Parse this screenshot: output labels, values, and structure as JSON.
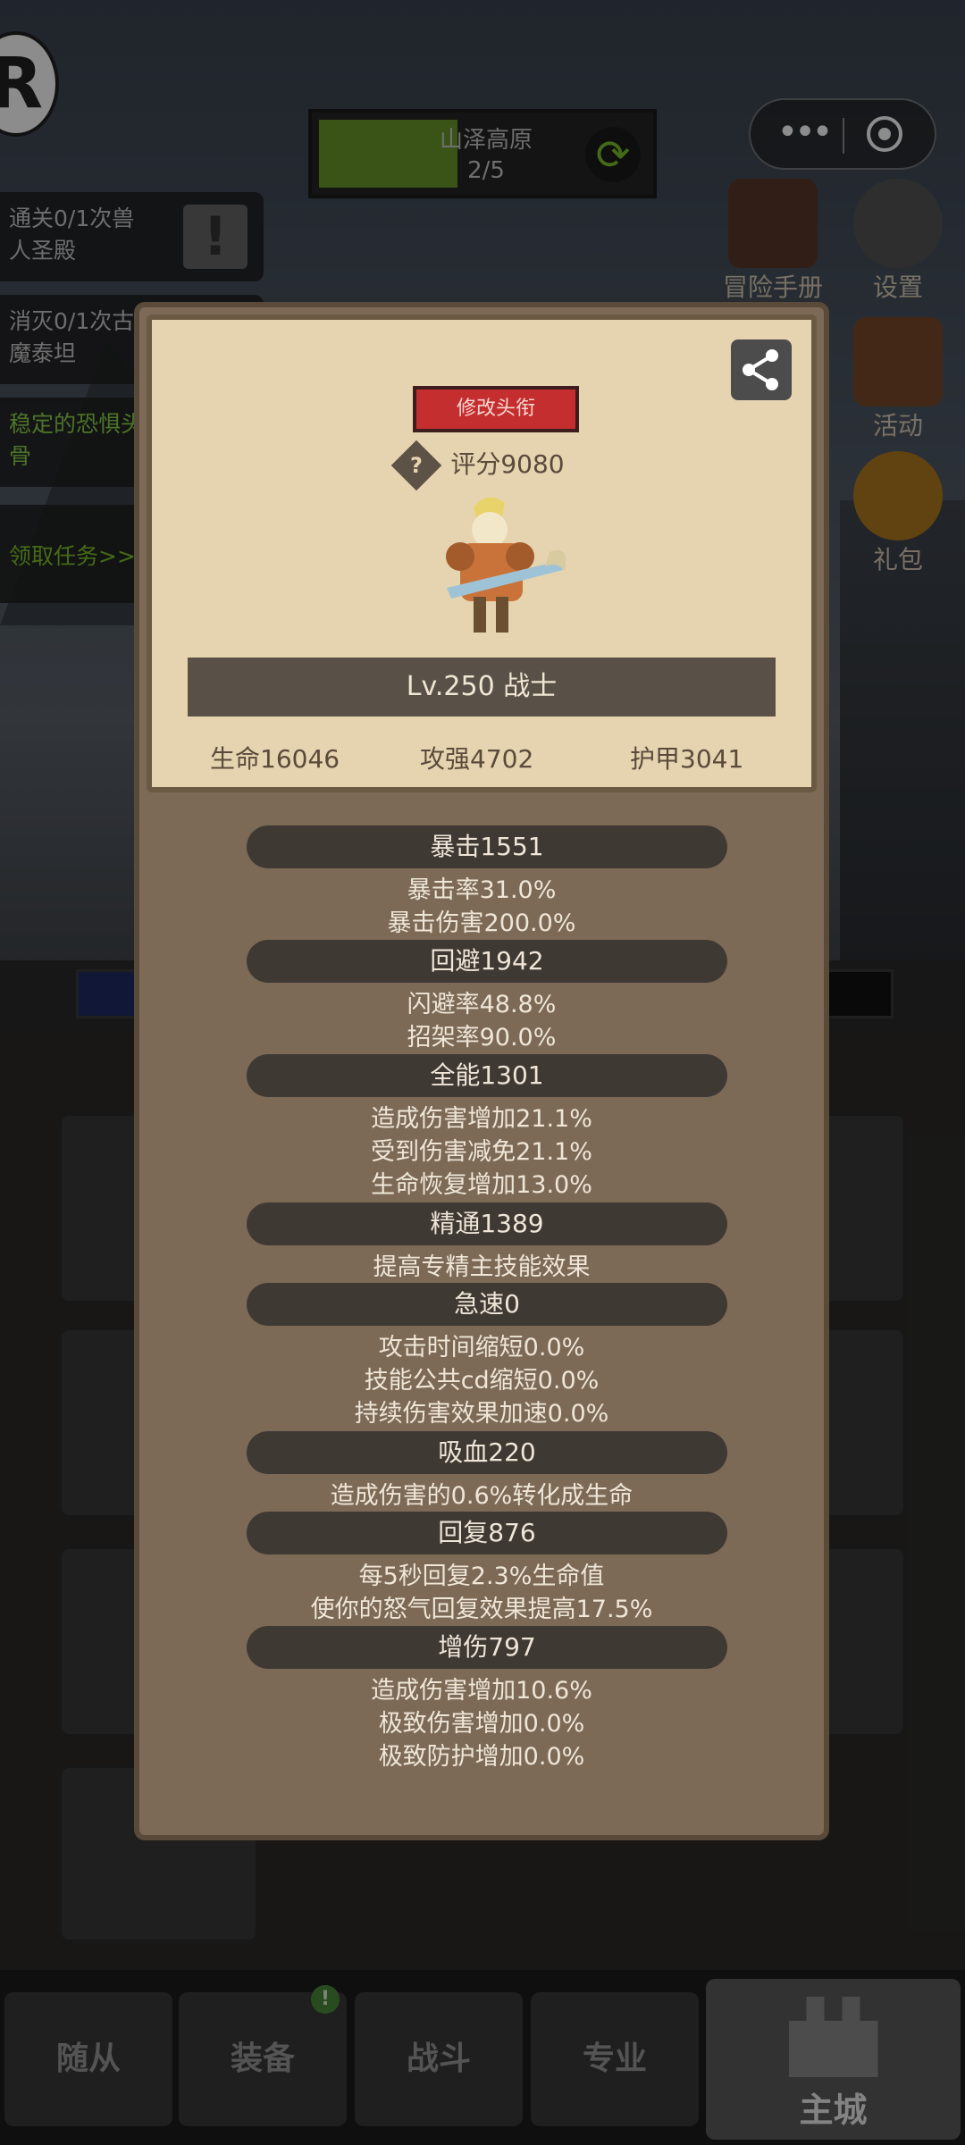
{
  "capsule": {
    "more_glyph": "•••"
  },
  "stage": {
    "name": "山泽高原",
    "count": "2/5",
    "cycle_glyph": "⟳"
  },
  "logo_letter": "R",
  "right_icons": [
    {
      "label": "冒险手册",
      "icon": "book-icon"
    },
    {
      "label": "设置",
      "icon": "gear-icon"
    },
    {
      "label": "活动",
      "icon": "scroll-icon"
    },
    {
      "label": "礼包",
      "icon": "gift-coin-icon"
    }
  ],
  "quests": [
    {
      "line1": "通关0/1次兽",
      "line2": "人圣殿",
      "badge": "!"
    },
    {
      "line1": "消灭0/1次古",
      "line2": "魔泰坦"
    },
    {
      "line1": "稳定的恐惧头",
      "line2": "骨"
    },
    {
      "line1": "领取任务>>"
    }
  ],
  "popup": {
    "rename_label": "修改头衔",
    "question_glyph": "?",
    "rating": "评分9080",
    "level": "Lv.250 战士",
    "basic": {
      "hp": "生命16046",
      "atk": "攻强4702",
      "armor": "护甲3041"
    },
    "groups": [
      {
        "title": "暴击1551",
        "lines": [
          "暴击率31.0%",
          "暴击伤害200.0%"
        ]
      },
      {
        "title": "回避1942",
        "lines": [
          "闪避率48.8%",
          "招架率90.0%"
        ]
      },
      {
        "title": "全能1301",
        "lines": [
          "造成伤害增加21.1%",
          "受到伤害减免21.1%",
          "生命恢复增加13.0%"
        ]
      },
      {
        "title": "精通1389",
        "lines": [
          "提高专精主技能效果"
        ]
      },
      {
        "title": "急速0",
        "lines": [
          "攻击时间缩短0.0%",
          "技能公共cd缩短0.0%",
          "持续伤害效果加速0.0%"
        ]
      },
      {
        "title": "吸血220",
        "lines": [
          "造成伤害的0.6%转化成生命"
        ]
      },
      {
        "title": "回复876",
        "lines": [
          "每5秒回复2.3%生命值",
          "使你的怒气回复效果提高17.5%"
        ]
      },
      {
        "title": "增伤797",
        "lines": [
          "造成伤害增加10.6%",
          "极致伤害增加0.0%",
          "极致防护增加0.0%"
        ]
      }
    ]
  },
  "nav": {
    "tabs": [
      "随从",
      "装备",
      "战斗",
      "专业"
    ],
    "city": "主城",
    "badge": "!"
  },
  "colors": {
    "accent_red": "#c42e2e",
    "progress_green": "#6a9a2d",
    "panel_brown": "#7c6a56",
    "card_parchment": "#e6d4b0"
  }
}
